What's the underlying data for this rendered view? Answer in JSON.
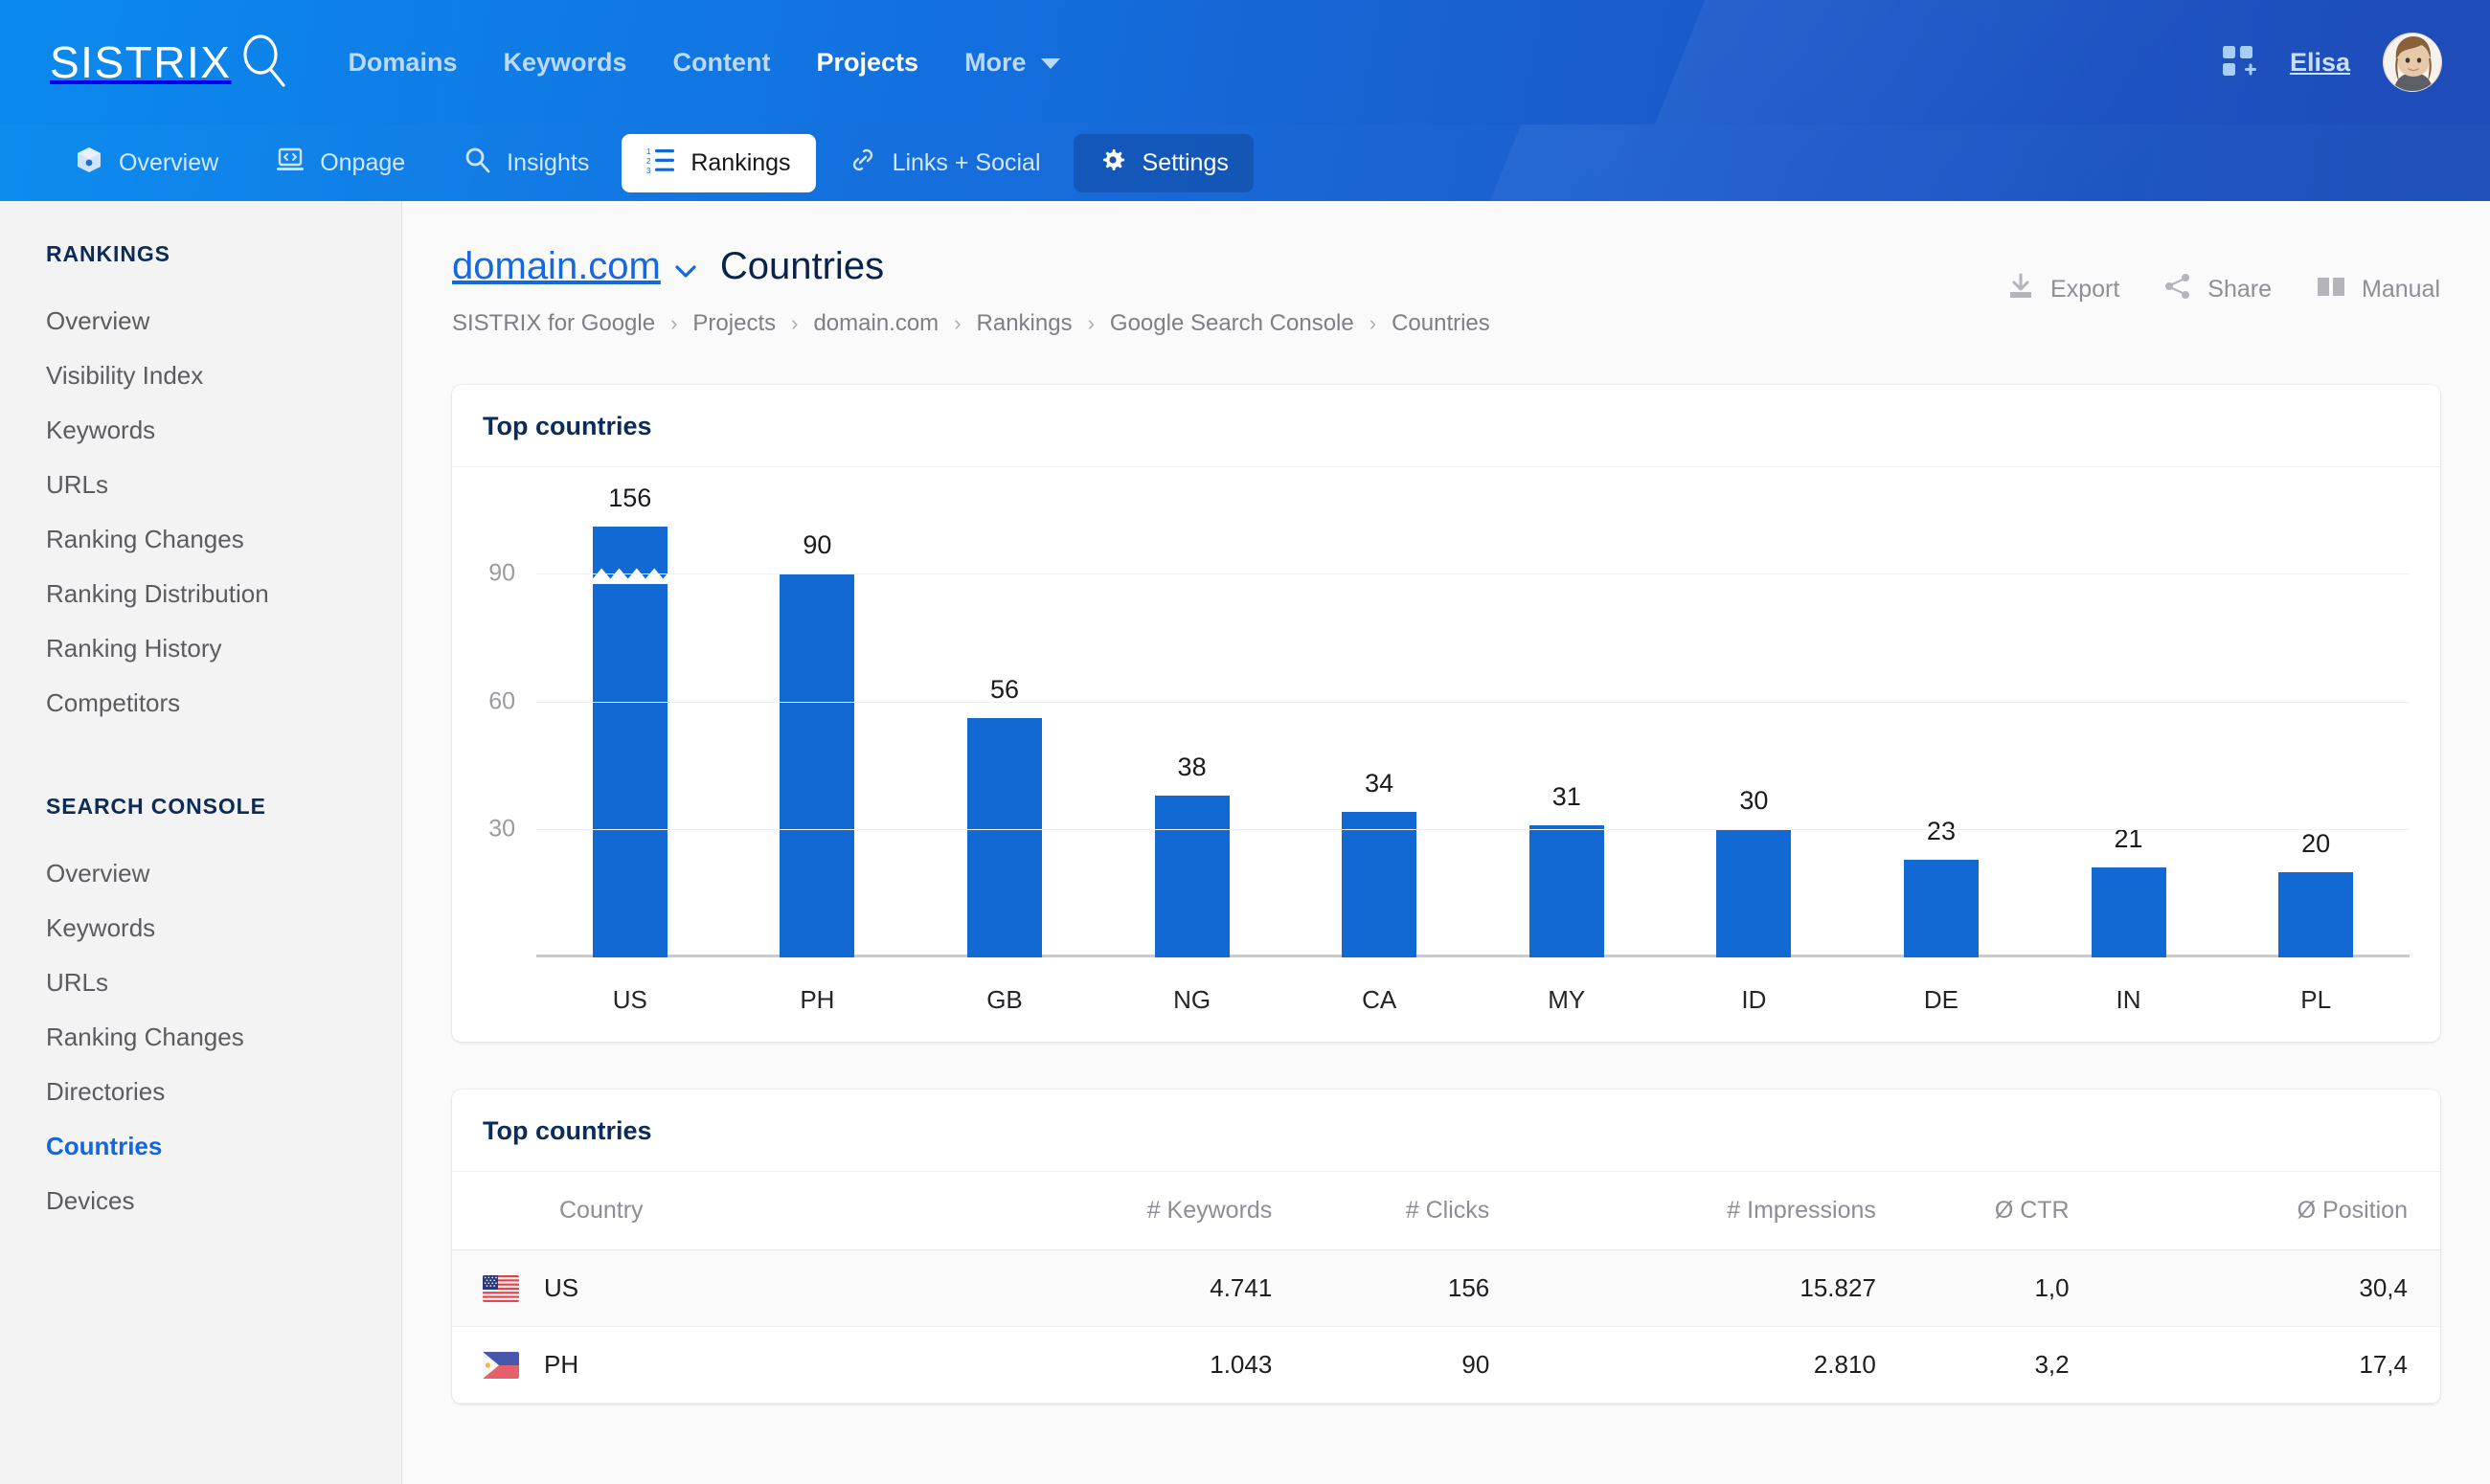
{
  "header": {
    "logo_text": "SISTRIX",
    "logo_icon": "magnifier-icon",
    "nav": [
      {
        "label": "Domains",
        "active": false
      },
      {
        "label": "Keywords",
        "active": false
      },
      {
        "label": "Content",
        "active": false
      },
      {
        "label": "Projects",
        "active": true
      },
      {
        "label": "More",
        "active": false,
        "icon": "chevron-down-icon"
      }
    ],
    "apps_icon": "apps-grid-add-icon",
    "user_name": "Elisa"
  },
  "subnav": [
    {
      "label": "Overview",
      "icon": "cube-icon",
      "state": "normal"
    },
    {
      "label": "Onpage",
      "icon": "laptop-code-icon",
      "state": "normal"
    },
    {
      "label": "Insights",
      "icon": "search-icon",
      "state": "normal"
    },
    {
      "label": "Rankings",
      "icon": "numbered-list-icon",
      "state": "active"
    },
    {
      "label": "Links + Social",
      "icon": "link-icon",
      "state": "normal"
    },
    {
      "label": "Settings",
      "icon": "gear-icon",
      "state": "shaded"
    }
  ],
  "sidebar": {
    "group1_title": "RANKINGS",
    "group1_items": [
      {
        "label": "Overview",
        "active": false
      },
      {
        "label": "Visibility Index",
        "active": false
      },
      {
        "label": "Keywords",
        "active": false
      },
      {
        "label": "URLs",
        "active": false
      },
      {
        "label": "Ranking Changes",
        "active": false
      },
      {
        "label": "Ranking Distribution",
        "active": false
      },
      {
        "label": "Ranking History",
        "active": false
      },
      {
        "label": "Competitors",
        "active": false
      }
    ],
    "group2_title": "SEARCH CONSOLE",
    "group2_items": [
      {
        "label": "Overview",
        "active": false
      },
      {
        "label": "Keywords",
        "active": false
      },
      {
        "label": "URLs",
        "active": false
      },
      {
        "label": "Ranking Changes",
        "active": false
      },
      {
        "label": "Directories",
        "active": false
      },
      {
        "label": "Countries",
        "active": true
      },
      {
        "label": "Devices",
        "active": false
      }
    ]
  },
  "page": {
    "domain": "domain.com",
    "domain_chevron": "chevron-down-icon",
    "title": "Countries",
    "breadcrumb": [
      "SISTRIX for Google",
      "Projects",
      "domain.com",
      "Rankings",
      "Google Search Console",
      "Countries"
    ],
    "breadcrumb_separator": "›",
    "actions": [
      {
        "label": "Export",
        "icon": "download-icon"
      },
      {
        "label": "Share",
        "icon": "share-nodes-icon"
      },
      {
        "label": "Manual",
        "icon": "book-icon"
      }
    ]
  },
  "chart_card": {
    "title": "Top countries"
  },
  "chart_data": {
    "type": "bar",
    "title": "Top countries",
    "xlabel": "",
    "ylabel": "",
    "categories": [
      "US",
      "PH",
      "GB",
      "NG",
      "CA",
      "MY",
      "ID",
      "DE",
      "IN",
      "PL"
    ],
    "values": [
      156,
      90,
      56,
      38,
      34,
      31,
      30,
      23,
      21,
      20
    ],
    "data_labels": [
      "156",
      "90",
      "56",
      "38",
      "34",
      "31",
      "30",
      "23",
      "21",
      "20"
    ],
    "yticks": [
      30,
      60,
      90
    ],
    "ytick_labels": [
      "30",
      "60",
      "90"
    ],
    "ylim": [
      0,
      105
    ],
    "grid": true,
    "legend": "none",
    "bar_color": "#1269d3",
    "truncated_bars": [
      "US"
    ],
    "truncation_marker": "zigzag-break",
    "note": "US bar is axis-broken (zigzag) because 156 exceeds the plotted range"
  },
  "table_card": {
    "title": "Top countries",
    "columns": [
      "Country",
      "# Keywords",
      "# Clicks",
      "# Impressions",
      "Ø CTR",
      "Ø Position"
    ],
    "rows": [
      {
        "flag": "flag-us",
        "country": "US",
        "keywords": "4.741",
        "clicks": "156",
        "impressions": "15.827",
        "ctr": "1,0",
        "position": "30,4"
      },
      {
        "flag": "flag-ph",
        "country": "PH",
        "keywords": "1.043",
        "clicks": "90",
        "impressions": "2.810",
        "ctr": "3,2",
        "position": "17,4"
      }
    ]
  },
  "colors": {
    "brand_blue": "#1668dc",
    "bar_blue": "#1269d3",
    "navy": "#0a2348",
    "muted": "#8d8d95"
  }
}
